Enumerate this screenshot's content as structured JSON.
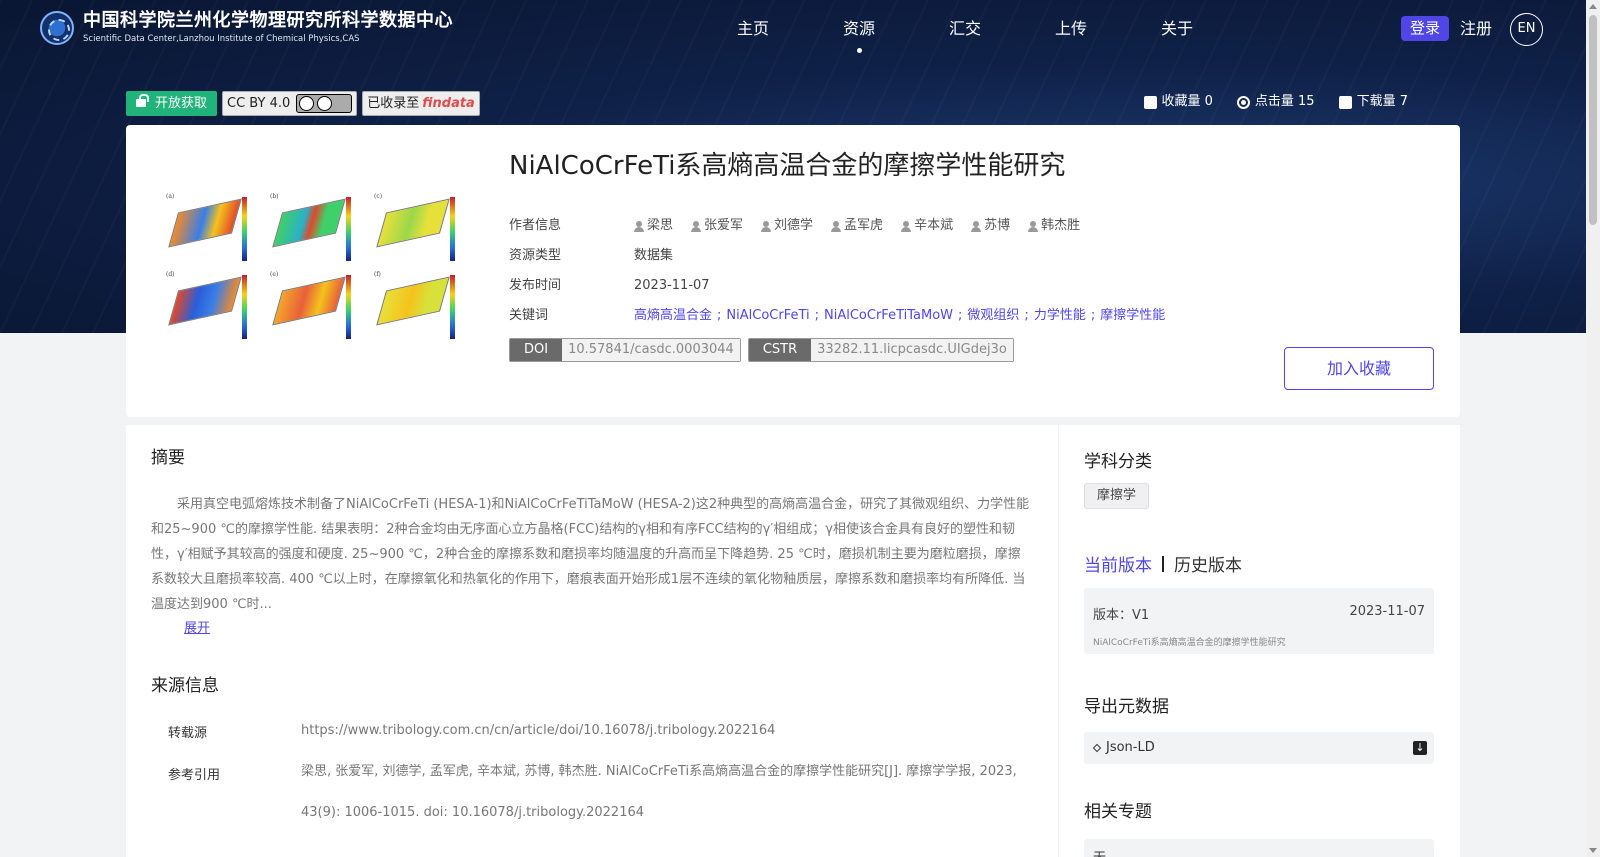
{
  "header": {
    "logo_title": "中国科学院兰州化学物理研究所科学数据中心",
    "logo_subtitle": "Scientific Data Center,Lanzhou Institute of Chemical Physics,CAS",
    "nav": [
      {
        "label": "主页",
        "active": false
      },
      {
        "label": "资源",
        "active": true
      },
      {
        "label": "汇交",
        "active": false
      },
      {
        "label": "上传",
        "active": false
      },
      {
        "label": "关于",
        "active": false
      }
    ],
    "login": "登录",
    "register": "注册",
    "language": "EN"
  },
  "badges": {
    "open_access": "开放获取",
    "license": "CC BY 4.0",
    "indexed_prefix": "已收录至",
    "indexed_logo": "findata"
  },
  "stats": {
    "favorites": "收藏量 0",
    "views": "点击量 15",
    "downloads": "下载量 7"
  },
  "dataset": {
    "title": "NiAlCoCrFeTi系高熵高温合金的摩擦学性能研究",
    "thumbnail_panels": [
      "(a)",
      "(b)",
      "(c)",
      "(d)",
      "(e)",
      "(f)"
    ],
    "authors_label": "作者信息",
    "authors": [
      "梁思",
      "张爱军",
      "刘德学",
      "孟军虎",
      "辛本斌",
      "苏博",
      "韩杰胜"
    ],
    "type_label": "资源类型",
    "type": "数据集",
    "date_label": "发布时间",
    "date": "2023-11-07",
    "keywords_label": "关键词",
    "keywords": [
      "高熵高温合金",
      "NiAlCoCrFeTi",
      "NiAlCoCrFeTiTaMoW",
      "微观组织",
      "力学性能",
      "摩擦学性能"
    ],
    "doi_label": "DOI",
    "doi": "10.57841/casdc.0003044",
    "cstr_label": "CSTR",
    "cstr": "33282.11.licpcasdc.UIGdej3o",
    "favorite_button": "加入收藏"
  },
  "abstract": {
    "title": "摘要",
    "text": "采用真空电弧熔炼技术制备了NiAlCoCrFeTi (HESA-1)和NiAlCoCrFeTiTaMoW (HESA-2)这2种典型的高熵高温合金，研究了其微观组织、力学性能和25~900 ℃的摩擦学性能. 结果表明：2种合金均由无序面心立方晶格(FCC)结构的γ相和有序FCC结构的γ′相组成；γ相使该合金具有良好的塑性和韧性，γ′相赋予其较高的强度和硬度. 25~900 ℃，2种合金的摩擦系数和磨损率均随温度的升高而呈下降趋势. 25 ℃时，磨损机制主要为磨粒磨损，摩擦系数较大且磨损率较高. 400 ℃以上时，在摩擦氧化和热氧化的作用下，磨痕表面开始形成1层不连续的氧化物釉质层，摩擦系数和磨损率均有所降低. 当温度达到900 ℃时...",
    "expand": "展开"
  },
  "source": {
    "title": "来源信息",
    "reprint_label": "转载源",
    "reprint_url": "https://www.tribology.com.cn/cn/article/doi/10.16078/j.tribology.2022164",
    "citation_label": "参考引用",
    "citation_line1": "梁思, 张爱军, 刘德学, 孟军虎, 辛本斌, 苏博, 韩杰胜. NiAlCoCrFeTi系高熵高温合金的摩擦学性能研究[J]. 摩擦学学报, 2023,",
    "citation_line2": "43(9): 1006-1015. doi: 10.16078/j.tribology.2022164"
  },
  "sidebar": {
    "subject_title": "学科分类",
    "subject": "摩擦学",
    "current_version": "当前版本",
    "history_version": "历史版本",
    "version": "版本：V1",
    "version_date": "2023-11-07",
    "version_name": "NiAlCoCrFeTi系高熵高温合金的摩擦学性能研究",
    "export_title": "导出元数据",
    "export_format": "Json-LD",
    "topics_title": "相关专题",
    "topics_value": "无"
  },
  "colors": {
    "accent": "#4f46e5",
    "open_access": "#20b37a",
    "hero_dark": "#0a1632"
  }
}
